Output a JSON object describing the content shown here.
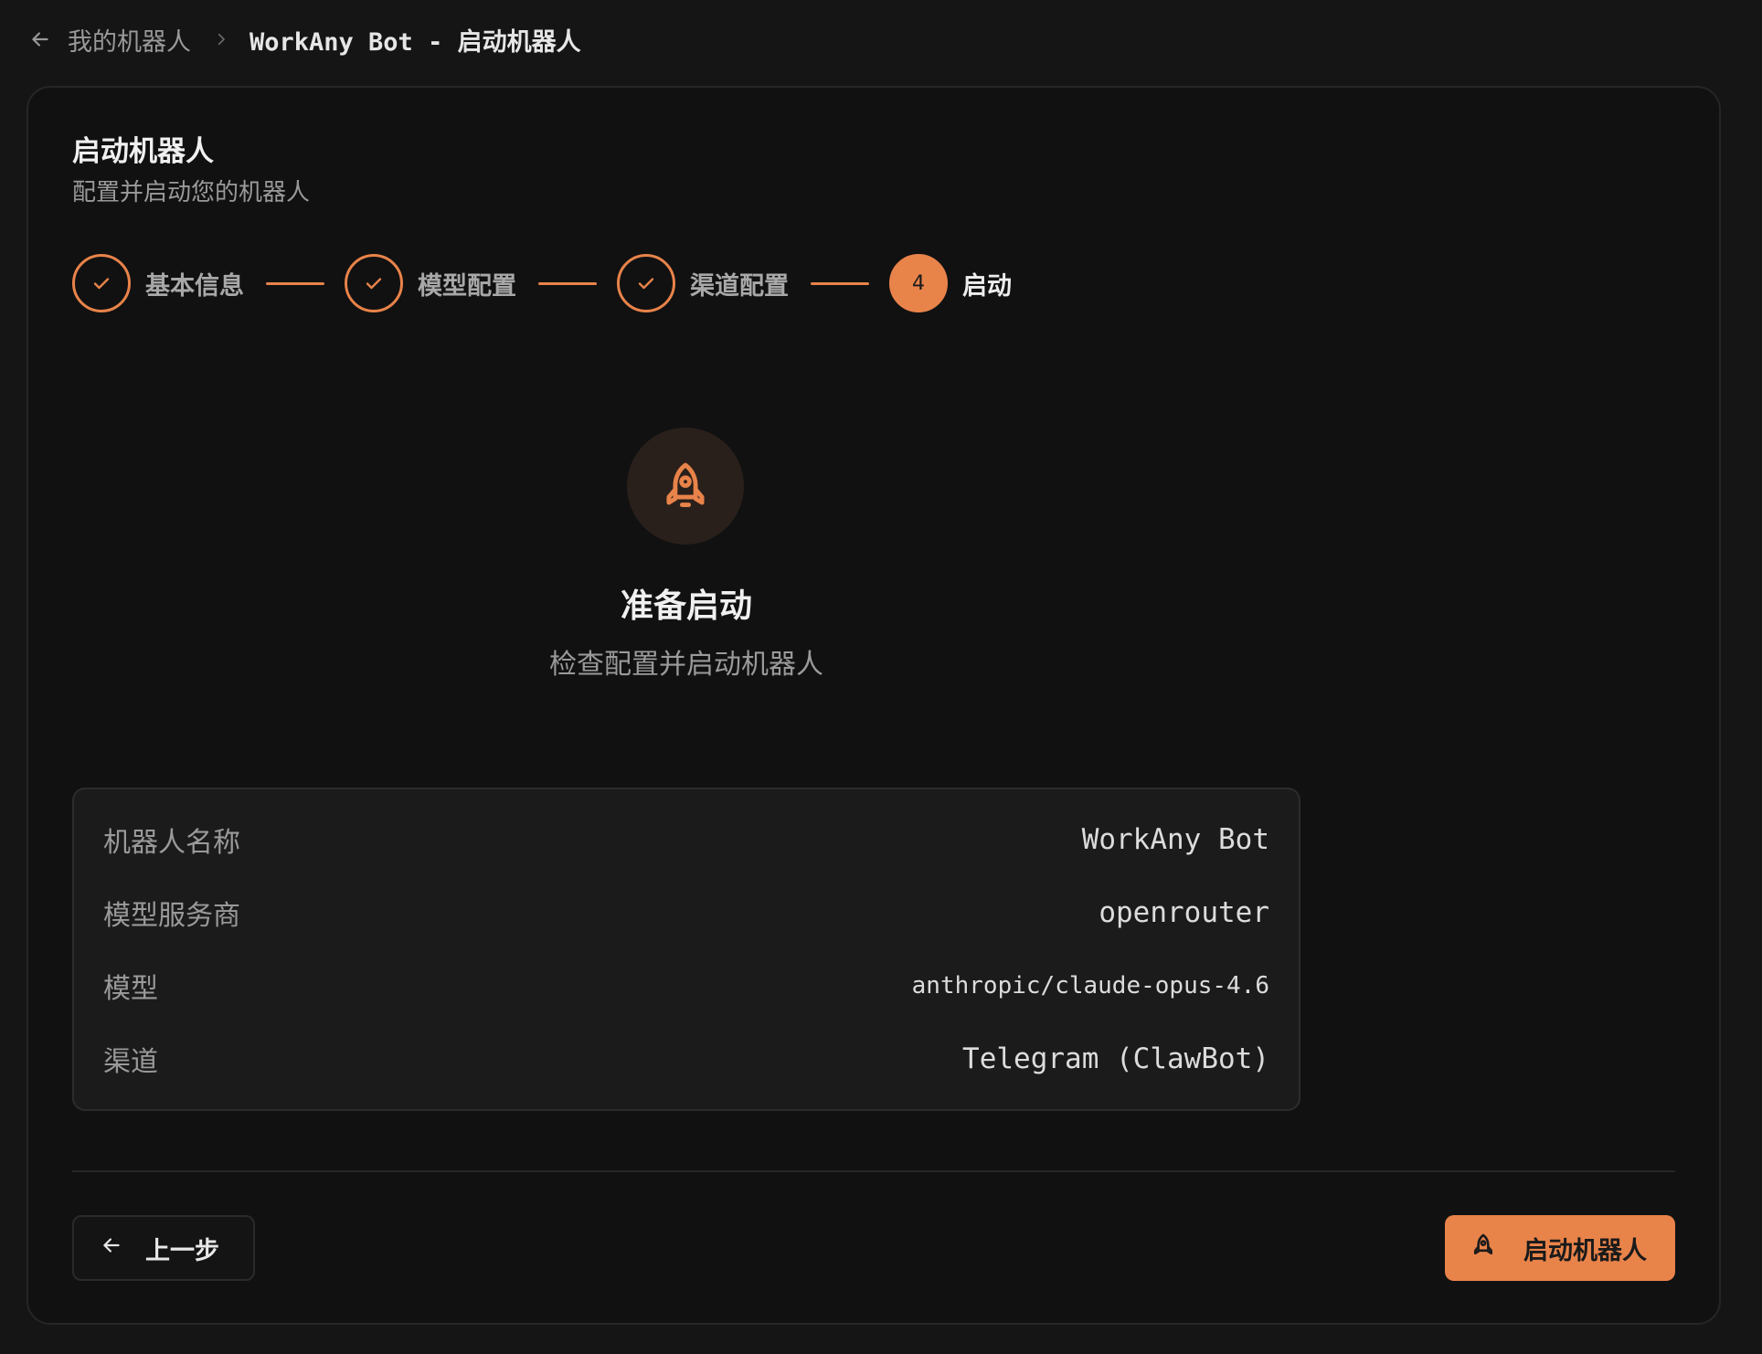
{
  "breadcrumb": {
    "parent": "我的机器人",
    "current": "WorkAny Bot - 启动机器人"
  },
  "card": {
    "title": "启动机器人",
    "subtitle": "配置并启动您的机器人"
  },
  "steps": [
    {
      "label": "基本信息",
      "status": "done"
    },
    {
      "label": "模型配置",
      "status": "done"
    },
    {
      "label": "渠道配置",
      "status": "done"
    },
    {
      "label": "启动",
      "status": "active",
      "number": "4"
    }
  ],
  "hero": {
    "title": "准备启动",
    "subtitle": "检查配置并启动机器人"
  },
  "summary": [
    {
      "key": "机器人名称",
      "value": "WorkAny Bot"
    },
    {
      "key": "模型服务商",
      "value": "openrouter"
    },
    {
      "key": "模型",
      "value": "anthropic/claude-opus-4.6"
    },
    {
      "key": "渠道",
      "value": "Telegram (ClawBot)"
    }
  ],
  "actions": {
    "prev_label": "上一步",
    "launch_label": "启动机器人"
  },
  "colors": {
    "accent": "#e8834a",
    "background": "#151515",
    "card": "#111111"
  },
  "icons": {
    "back": "arrow-left-icon",
    "separator": "chevron-right-icon",
    "step_done": "check-icon",
    "hero": "rocket-icon",
    "launch": "rocket-icon"
  }
}
